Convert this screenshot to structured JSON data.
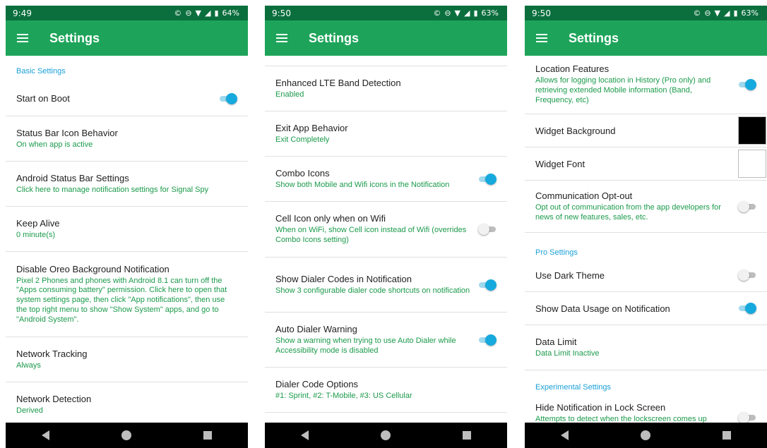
{
  "colors": {
    "accent": "#1ea45a",
    "status_bar": "#0a6f3d",
    "section": "#1aa0d8",
    "summary": "#1b9a4b",
    "toggle_on": "#16a9dd"
  },
  "screens": [
    {
      "status": {
        "time": "9:49",
        "battery": "64%"
      },
      "appbar": {
        "title": "Settings",
        "menu_icon": "hamburger-menu-icon"
      },
      "section_basic": "Basic Settings",
      "start_on_boot": {
        "title": "Start on Boot",
        "checked": true
      },
      "status_bar_icon": {
        "title": "Status Bar Icon Behavior",
        "summary": "On when app is active"
      },
      "android_status": {
        "title": "Android Status Bar Settings",
        "summary": "Click here to manage notification settings for Signal Spy"
      },
      "keep_alive": {
        "title": "Keep Alive",
        "summary": "0 minute(s)"
      },
      "oreo": {
        "title": "Disable Oreo Background Notification",
        "summary": "Pixel 2 Phones and phones with Android 8.1 can turn off the \"Apps consuming battery\" permission.  Click here to open that system settings page, then click \"App notifications\", then use the top right menu to show \"Show System\" apps, and go to \"Android System\"."
      },
      "network_tracking": {
        "title": "Network Tracking",
        "summary": "Always"
      },
      "network_detection": {
        "title": "Network Detection",
        "summary": "Derived"
      }
    },
    {
      "status": {
        "time": "9:50",
        "battery": "63%"
      },
      "appbar": {
        "title": "Settings",
        "menu_icon": "hamburger-menu-icon"
      },
      "lte_band": {
        "title": "Enhanced LTE Band Detection",
        "summary": "Enabled"
      },
      "exit_app": {
        "title": "Exit App Behavior",
        "summary": "Exit Completely"
      },
      "combo_icons": {
        "title": "Combo Icons",
        "summary": "Show both Mobile and Wifi icons in the Notification",
        "checked": true
      },
      "cell_icon": {
        "title": "Cell Icon only when on Wifi",
        "summary": "When on WiFi, show Cell icon instead of Wifi (overrides Combo Icons setting)",
        "checked": false
      },
      "dialer_codes": {
        "title": "Show Dialer Codes in Notification",
        "summary": "Show 3 configurable dialer code shortcuts on notification",
        "checked": true
      },
      "auto_dialer": {
        "title": "Auto Dialer Warning",
        "summary": "Show a warning when trying to use Auto Dialer while Accessibility mode is disabled",
        "checked": true
      },
      "dialer_options": {
        "title": "Dialer Code Options",
        "summary": "#1: Sprint, #2: T-Mobile, #3: US Cellular"
      }
    },
    {
      "status": {
        "time": "9:50",
        "battery": "63%"
      },
      "appbar": {
        "title": "Settings",
        "menu_icon": "hamburger-menu-icon"
      },
      "location": {
        "title": "Location Features",
        "summary": "Allows for logging location in History (Pro only) and retrieving extended Mobile information (Band, Frequency, etc)",
        "checked": true
      },
      "widget_bg": {
        "title": "Widget Background",
        "color": "#000000"
      },
      "widget_font": {
        "title": "Widget Font",
        "color": "#ffffff"
      },
      "opt_out": {
        "title": "Communication Opt-out",
        "summary": "Opt out of communication from the app developers for news of new features, sales, etc.",
        "checked": false
      },
      "section_pro": "Pro Settings",
      "dark_theme": {
        "title": "Use Dark Theme",
        "checked": false
      },
      "data_usage": {
        "title": "Show Data Usage on Notification",
        "checked": true
      },
      "data_limit": {
        "title": "Data Limit",
        "summary": "Data Limit Inactive"
      },
      "section_exp": "Experimental Settings",
      "hide_lock": {
        "title": "Hide Notification in Lock Screen",
        "summary": "Attempts to detect when the lockscreen comes up",
        "checked": false
      }
    }
  ]
}
